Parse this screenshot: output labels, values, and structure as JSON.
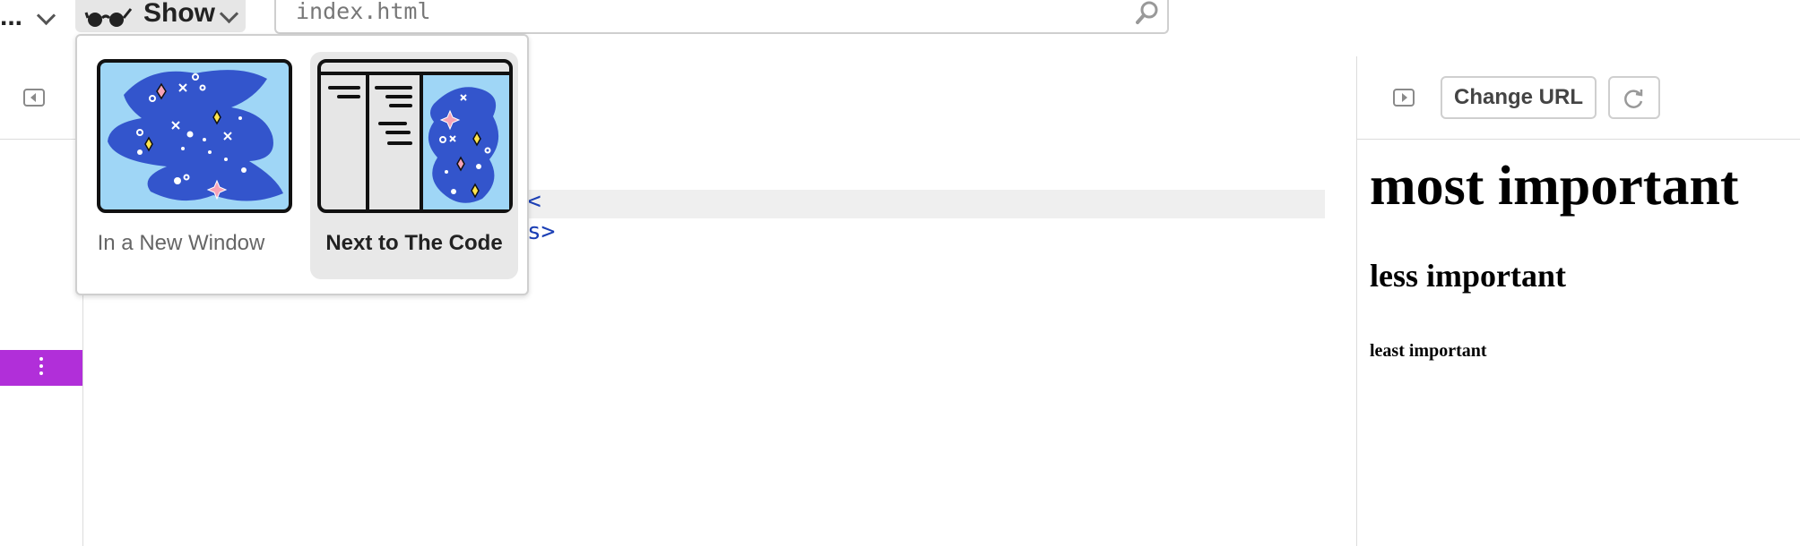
{
  "topbar": {
    "truncated_label": "...",
    "show_label": "Show",
    "url_value": "index.html"
  },
  "popover": {
    "options": [
      {
        "label": "In a New Window",
        "selected": false
      },
      {
        "label": "Next to The Code",
        "selected": true
      }
    ]
  },
  "editor": {
    "fragment_1": "<",
    "fragment_2": "s>"
  },
  "preview": {
    "change_url_label": "Change URL",
    "heading_1": "most important",
    "heading_2": "less important",
    "heading_3": "least important"
  },
  "colors": {
    "accent_purple": "#b12fd9",
    "illustration_blue": "#3355cc",
    "illustration_sky": "#9fd6f6",
    "code_blue": "#1b3fb5"
  }
}
